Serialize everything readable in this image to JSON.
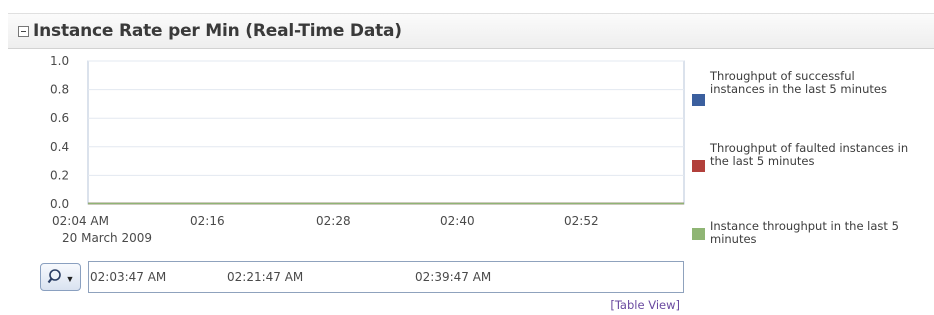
{
  "panel": {
    "title": "Instance Rate per Min (Real-Time Data)",
    "collapse_icon": "minus-box-icon"
  },
  "chart_data": {
    "type": "line",
    "title": "",
    "xlabel": "",
    "ylabel": "",
    "ylim": [
      0.0,
      1.0
    ],
    "y_ticks": [
      "0.0",
      "0.2",
      "0.4",
      "0.6",
      "0.8",
      "1.0"
    ],
    "x_ticks": [
      "02:04 AM",
      "02:16",
      "02:28",
      "02:40",
      "02:52"
    ],
    "x_date_label": "20 March 2009",
    "grid": true,
    "legend_position": "right",
    "series": [
      {
        "name": "Throughput of successful instances in the last 5 minutes",
        "color": "#3b5f9e",
        "values": [
          0,
          0,
          0,
          0,
          0,
          0
        ]
      },
      {
        "name": "Throughput of faulted instances in the last 5 minutes",
        "color": "#b2403b",
        "values": [
          0,
          0,
          0,
          0,
          0,
          0
        ]
      },
      {
        "name": "Instance throughput in the last 5 minutes",
        "color": "#8fb574",
        "values": [
          0,
          0,
          0,
          0,
          0,
          0
        ]
      }
    ]
  },
  "range_selector": {
    "labels": [
      "02:03:47 AM",
      "02:21:47 AM",
      "02:39:47 AM"
    ],
    "zoom_icon": "magnifier-dropdown-icon"
  },
  "links": {
    "table_view": "[Table View]"
  }
}
